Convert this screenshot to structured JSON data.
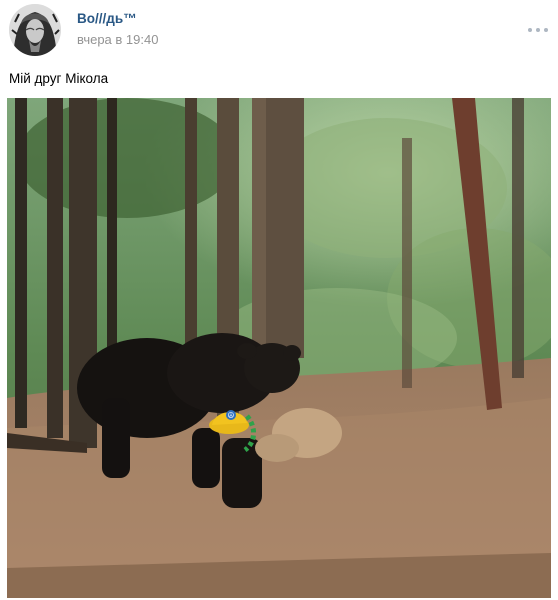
{
  "post": {
    "author": "Во///дь™",
    "time": "вчера в 19:40",
    "text": "Мій друг Мікола",
    "avatar_icon": "author-portrait-avatar",
    "more_icon": "three-dots-more-icon",
    "photo": {
      "subject": "black bear carrying a plush toy in a forest",
      "cap_badge": "☮"
    }
  },
  "colors": {
    "author_link": "#2a5885",
    "meta_text": "#939393",
    "dots": "#aeb7c2"
  }
}
